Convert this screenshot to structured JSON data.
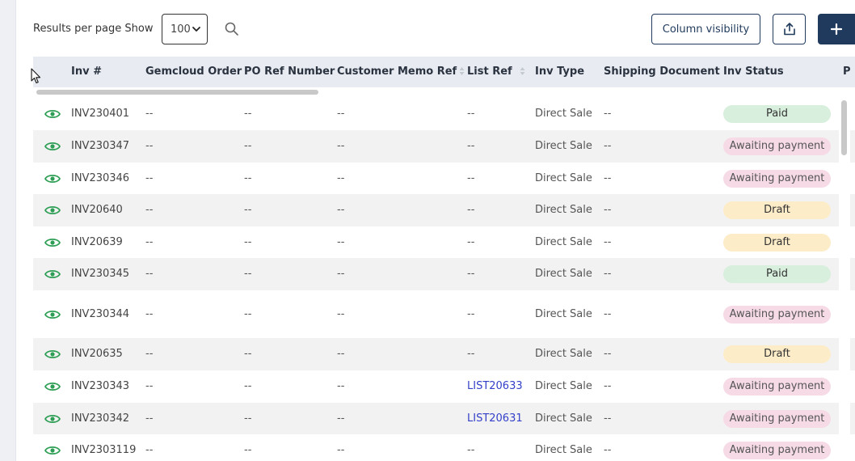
{
  "toolbar": {
    "results_label": "Results per page Show",
    "page_size": "100",
    "column_visibility_label": "Column visibility"
  },
  "table": {
    "columns": [
      "Inv #",
      "Gemcloud Order",
      "PO Ref Number",
      "Customer Memo Ref",
      "List Ref",
      "Inv Type",
      "Shipping Document",
      "Inv Status",
      "P"
    ],
    "rows": [
      {
        "inv": "INV230401",
        "gemcloud": "--",
        "po_ref": "--",
        "memo_ref": "--",
        "list_ref": "--",
        "inv_type": "Direct Sale",
        "shipping": "--",
        "status": "Paid"
      },
      {
        "inv": "INV230347",
        "gemcloud": "--",
        "po_ref": "--",
        "memo_ref": "--",
        "list_ref": "--",
        "inv_type": "Direct Sale",
        "shipping": "--",
        "status": "Awaiting payment"
      },
      {
        "inv": "INV230346",
        "gemcloud": "--",
        "po_ref": "--",
        "memo_ref": "--",
        "list_ref": "--",
        "inv_type": "Direct Sale",
        "shipping": "--",
        "status": "Awaiting payment"
      },
      {
        "inv": "INV20640",
        "gemcloud": "--",
        "po_ref": "--",
        "memo_ref": "--",
        "list_ref": "--",
        "inv_type": "Direct Sale",
        "shipping": "--",
        "status": "Draft"
      },
      {
        "inv": "INV20639",
        "gemcloud": "--",
        "po_ref": "--",
        "memo_ref": "--",
        "list_ref": "--",
        "inv_type": "Direct Sale",
        "shipping": "--",
        "status": "Draft"
      },
      {
        "inv": "INV230345",
        "gemcloud": "--",
        "po_ref": "--",
        "memo_ref": "--",
        "list_ref": "--",
        "inv_type": "Direct Sale",
        "shipping": "--",
        "status": "Paid"
      },
      {
        "inv": "INV230344",
        "gemcloud": "--",
        "po_ref": "--",
        "memo_ref": "--",
        "list_ref": "--",
        "inv_type": "Direct Sale",
        "shipping": "--",
        "status": "Awaiting payment"
      },
      {
        "inv": "INV20635",
        "gemcloud": "--",
        "po_ref": "--",
        "memo_ref": "--",
        "list_ref": "--",
        "inv_type": "Direct Sale",
        "shipping": "--",
        "status": "Draft"
      },
      {
        "inv": "INV230343",
        "gemcloud": "--",
        "po_ref": "--",
        "memo_ref": "--",
        "list_ref": "LIST20633",
        "inv_type": "Direct Sale",
        "shipping": "--",
        "status": "Awaiting payment"
      },
      {
        "inv": "INV230342",
        "gemcloud": "--",
        "po_ref": "--",
        "memo_ref": "--",
        "list_ref": "LIST20631",
        "inv_type": "Direct Sale",
        "shipping": "--",
        "status": "Awaiting payment"
      },
      {
        "inv": "INV2303119",
        "gemcloud": "--",
        "po_ref": "--",
        "memo_ref": "--",
        "list_ref": "--",
        "inv_type": "Direct Sale",
        "shipping": "--",
        "status": "Awaiting payment"
      }
    ]
  },
  "colors": {
    "primary": "#1f3a5c",
    "eye_icon": "#2e9e55",
    "link": "#3440c8",
    "paid_bg": "#d7efdc",
    "awaiting_bg": "#f6dbe6",
    "draft_bg": "#fdecc8",
    "header_bg": "#e8ecf2"
  }
}
